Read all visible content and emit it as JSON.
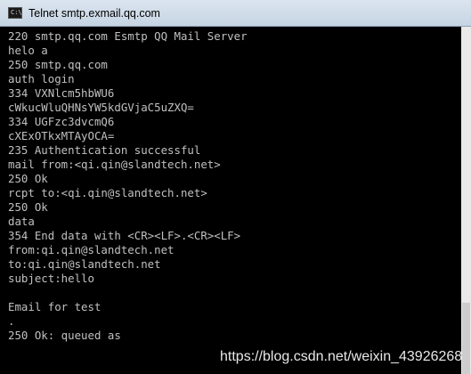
{
  "window": {
    "title": "Telnet smtp.exmail.qq.com",
    "icon": "console-icon",
    "icon_glyph": "C:\\",
    "background_color": "#000000",
    "text_color": "#c0c0c0"
  },
  "console": {
    "lines": [
      "220 smtp.qq.com Esmtp QQ Mail Server",
      "helo a",
      "250 smtp.qq.com",
      "auth login",
      "334 VXNlcm5hbWU6",
      "cWkucWluQHNsYW5kdGVjaC5uZXQ=",
      "334 UGFzc3dvcmQ6",
      "cXExOTkxMTAyOCA=",
      "235 Authentication successful",
      "mail from:<qi.qin@slandtech.net>",
      "250 Ok",
      "rcpt to:<qi.qin@slandtech.net>",
      "250 Ok",
      "data",
      "354 End data with <CR><LF>.<CR><LF>",
      "from:qi.qin@slandtech.net",
      "to:qi.qin@slandtech.net",
      "subject:hello",
      "",
      "Email for test",
      ".",
      "250 Ok: queued as"
    ]
  },
  "watermark": "https://blog.csdn.net/weixin_43926268"
}
